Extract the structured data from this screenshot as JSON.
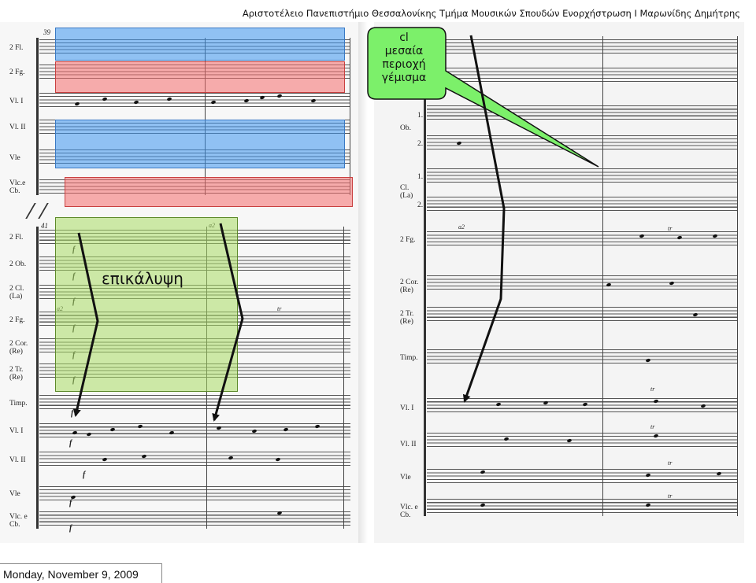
{
  "header": {
    "text": "Αριστοτέλειο Πανεπιστήμιο Θεσσαλονίκης Τμήμα Μουσικών Σπουδών  Ενορχήστρωση Ι Μαρωνίδης Δημήτρης"
  },
  "annotations": {
    "overlap_label": "επικάλυψη",
    "callout_lines": [
      "cl",
      "μεσαία",
      "περιοχή",
      "γέμισμα"
    ],
    "colors": {
      "blue_highlight": "#3c96f0",
      "red_highlight": "#f56e6e",
      "green_highlight": "#aadc64",
      "callout_fill": "#7cf06a",
      "arrow": "#111111"
    }
  },
  "score": {
    "left_top_system": {
      "measure_number": "39",
      "staves": [
        "2 Fl.",
        "2 Fg.",
        "Vl. I",
        "Vl. II",
        "Vle",
        "Vlc.e\nCb."
      ]
    },
    "left_bottom_system": {
      "measure_number": "41",
      "staves": [
        "2 Fl.",
        "2 Ob.",
        "2 Cl.\n(La)",
        "2 Fg.",
        "2 Cor.\n(Re)",
        "2 Tr.\n(Re)",
        "Timp.",
        "Vl. I",
        "Vl. II",
        "Vle",
        "Vlc. e\nCb."
      ],
      "dynamics": [
        "f",
        "f",
        "f",
        "f",
        "f",
        "f",
        "f",
        "f",
        "f",
        "f",
        "f"
      ],
      "markings": [
        "a2",
        "tr",
        "a2"
      ]
    },
    "right_system": {
      "staves": [
        "1.",
        "Ob.",
        "2.",
        "1.",
        "Cl.\n(La)",
        "2.",
        "2 Fg.",
        "2 Cor.\n(Re)",
        "2 Tr.\n(Re)",
        "Timp.",
        "Vl. I",
        "Vl. II",
        "Vle",
        "Vlc. e\nCb."
      ],
      "markings": [
        "a2",
        "tr",
        "tr",
        "tr",
        "tr",
        "tr"
      ]
    }
  },
  "footer": {
    "date": "Monday, November 9, 2009"
  }
}
